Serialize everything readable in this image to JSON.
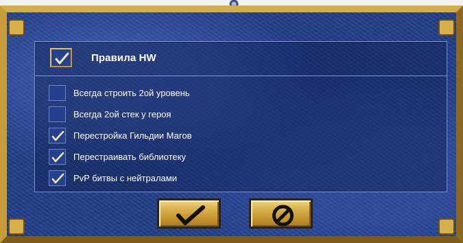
{
  "dialog": {
    "header": {
      "label": "Правила HW",
      "checked": true
    },
    "options": [
      {
        "label": "Всегда строить 2ой уровень",
        "checked": false
      },
      {
        "label": "Всегда 2ой стек у героя",
        "checked": false
      },
      {
        "label": "Перестройка Гильдии Магов",
        "checked": true
      },
      {
        "label": "Перестраивать библиотеку",
        "checked": true
      },
      {
        "label": "PvP битвы с нейтралами",
        "checked": true
      }
    ],
    "buttons": {
      "ok_icon": "checkmark-icon",
      "cancel_icon": "cancel-icon"
    },
    "colors": {
      "background": "#23408e",
      "frame": "#b48a30",
      "checkmark": "#f0e6b0"
    }
  }
}
